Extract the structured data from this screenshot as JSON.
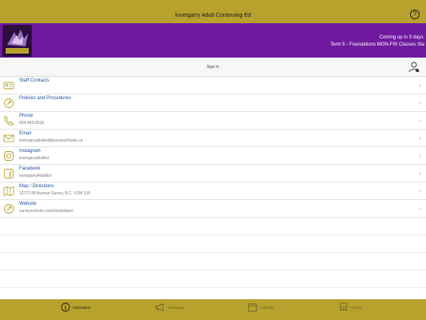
{
  "header": {
    "title": "Invergarry Adult Continuing Ed"
  },
  "banner": {
    "logo_text": "INVERGARRY EAGLES",
    "upcoming_line1": "Coming up in 3 days:",
    "upcoming_line2": "Term 5 - Foundations MON-FRI Classes Sta"
  },
  "signin": {
    "label": "Sign In"
  },
  "items": [
    {
      "title": "Staff Contacts",
      "subtitle": "",
      "icon": "contact-card-icon"
    },
    {
      "title": "Policies and Procedures",
      "subtitle": "",
      "icon": "link-icon"
    },
    {
      "title": "Phone",
      "subtitle": "604-585-8216",
      "icon": "phone-icon"
    },
    {
      "title": "Email",
      "subtitle": "invergaryadulted@surreyschools.ca",
      "icon": "envelope-icon"
    },
    {
      "title": "Instagram",
      "subtitle": "invergaryadulted",
      "icon": "instagram-icon"
    },
    {
      "title": "Facebook",
      "subtitle": "InvergarryAdultEd",
      "icon": "facebook-icon"
    },
    {
      "title": "Map / Directions",
      "subtitle": "12772 88 Avenue Surrey, B.C. V3W 3J9",
      "icon": "map-icon"
    },
    {
      "title": "Website",
      "subtitle": "surreyschools.ca/schools/iaec/",
      "icon": "globe-link-icon"
    }
  ],
  "tabs": [
    {
      "label": "Information",
      "icon": "info-icon",
      "active": true
    },
    {
      "label": "Messages",
      "icon": "megaphone-icon",
      "active": false
    },
    {
      "label": "Calendar",
      "icon": "calendar-icon",
      "active": false
    },
    {
      "label": "Groups",
      "icon": "groups-icon",
      "active": false
    }
  ],
  "colors": {
    "gold": "#b8a22d",
    "purple": "#6f1a9e",
    "link_blue": "#1f4f9e"
  }
}
